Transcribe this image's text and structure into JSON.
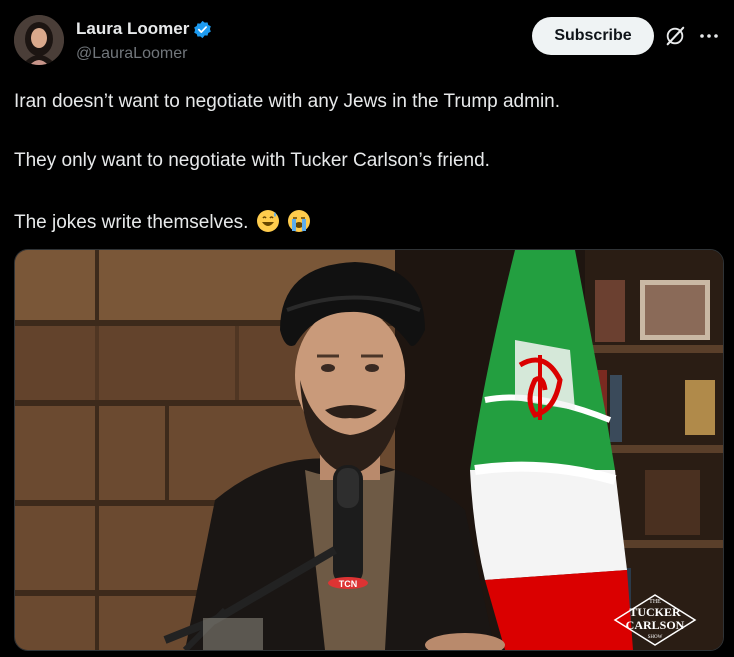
{
  "post": {
    "author_name": "Laura Loomer",
    "author_handle": "@LauraLoomer",
    "verified": true,
    "subscribe_label": "Subscribe",
    "text_lines": [
      "Iran doesn’t want to negotiate with any Jews in the Trump admin.",
      "They only want to negotiate with Tucker Carlson’s friend.",
      "The jokes write themselves."
    ],
    "emojis": [
      "grinning-face-with-sweat",
      "loudly-crying-face"
    ]
  },
  "media": {
    "mic_badge": "TCN",
    "watermark_lines": [
      "THE",
      "TUCKER",
      "CARLSON",
      "SHOW"
    ]
  },
  "colors": {
    "accent": "#1d9bf0",
    "background": "#000000",
    "text": "#e7e9ea",
    "muted": "#71767b"
  },
  "icons": [
    "verified-badge-icon",
    "grok-icon",
    "more-options-icon"
  ]
}
